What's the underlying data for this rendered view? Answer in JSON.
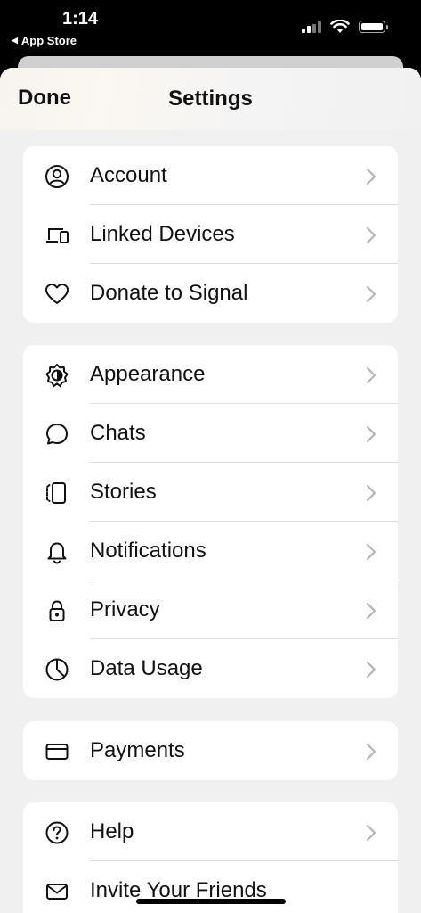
{
  "status_bar": {
    "time": "1:14",
    "back_app": "App Store"
  },
  "nav": {
    "done_label": "Done",
    "title": "Settings"
  },
  "groups": [
    {
      "items": [
        {
          "label": "Account",
          "icon": "account-icon"
        },
        {
          "label": "Linked Devices",
          "icon": "linked-devices-icon"
        },
        {
          "label": "Donate to Signal",
          "icon": "heart-icon"
        }
      ]
    },
    {
      "items": [
        {
          "label": "Appearance",
          "icon": "appearance-icon"
        },
        {
          "label": "Chats",
          "icon": "chat-bubble-icon"
        },
        {
          "label": "Stories",
          "icon": "stories-icon"
        },
        {
          "label": "Notifications",
          "icon": "bell-icon"
        },
        {
          "label": "Privacy",
          "icon": "lock-icon"
        },
        {
          "label": "Data Usage",
          "icon": "pie-chart-icon"
        }
      ]
    },
    {
      "items": [
        {
          "label": "Payments",
          "icon": "card-icon"
        }
      ]
    },
    {
      "items": [
        {
          "label": "Help",
          "icon": "help-icon"
        },
        {
          "label": "Invite Your Friends",
          "icon": "envelope-icon"
        }
      ]
    }
  ],
  "colors": {
    "background": "#f0f0f0",
    "card": "#ffffff",
    "text": "#111111",
    "chevron": "#b5b5b5"
  }
}
